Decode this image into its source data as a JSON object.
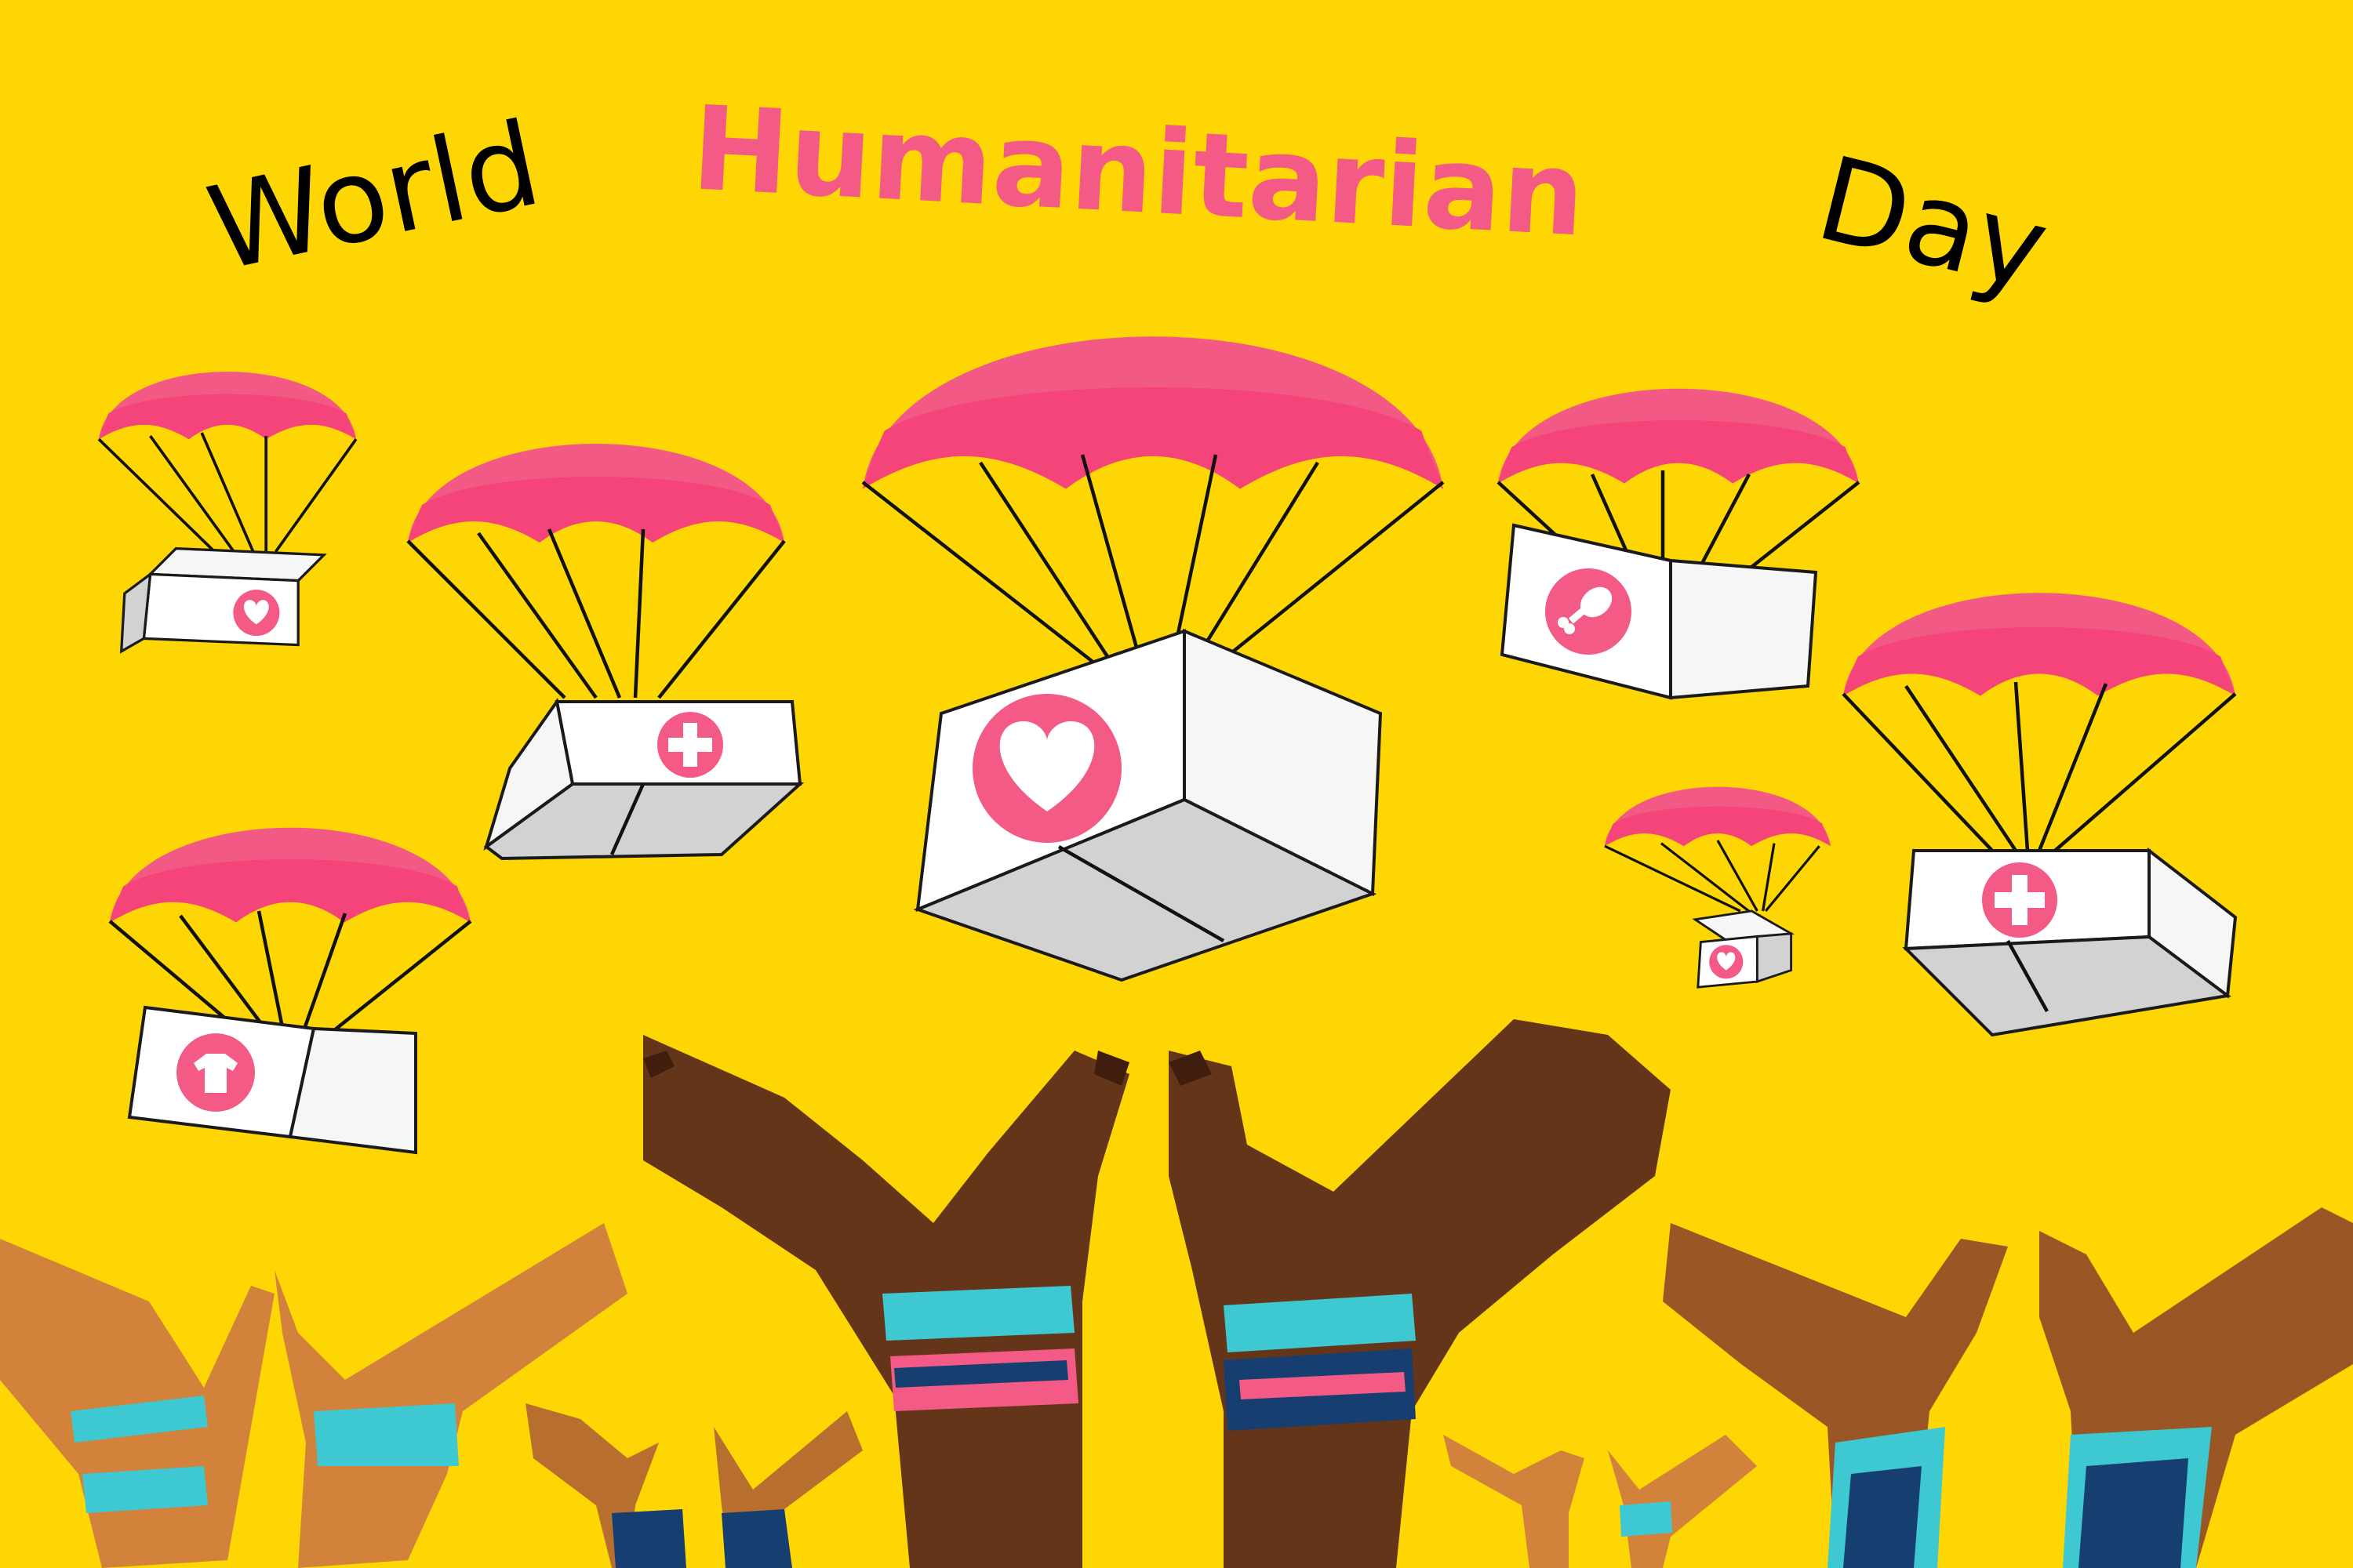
{
  "title": {
    "part1": "World",
    "part2": "Humanitarian",
    "part3": "Day"
  },
  "colors": {
    "background": "#fdd603",
    "accent_pink": "#f35a85",
    "text": "#000000",
    "box_white": "#ffffff",
    "box_shadow": "#d2d2d2"
  },
  "parachute_icons": [
    "heart-icon",
    "medical-cross-icon",
    "heart-icon",
    "food-drumstick-icon",
    "heart-icon",
    "clothing-shirt-icon",
    "heart-icon",
    "medical-cross-icon"
  ]
}
